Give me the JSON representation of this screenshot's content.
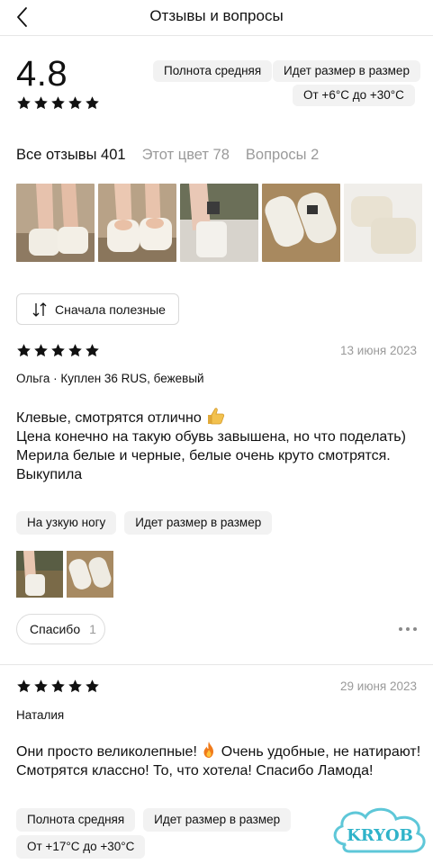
{
  "header": {
    "title": "Отзывы и вопросы",
    "back_icon": "chevron-left-icon"
  },
  "summary": {
    "rating": "4.8",
    "stars": 5,
    "chips": [
      "Полнота средняя",
      "Идет размер в размер",
      "От +6°C до +30°C"
    ]
  },
  "tabs": [
    {
      "label": "Все отзывы 401",
      "active": true
    },
    {
      "label": "Этот цвет 78",
      "active": false
    },
    {
      "label": "Вопросы 2",
      "active": false
    }
  ],
  "sort": {
    "label": "Сначала полезные",
    "icon": "sort-arrows-icon"
  },
  "reviews": [
    {
      "stars": 5,
      "date": "13 июня 2023",
      "author": "Ольга · Куплен 36 RUS, бежевый",
      "text_line_1": "Клевые, смотрятся отлично",
      "text_rest": "Цена конечно на такую обувь завышена, но что поделать)\nМерила белые и черные, белые очень круто смотрятся.\nВыкупила",
      "tags": [
        "На узкую ногу",
        "Идет размер в размер"
      ],
      "thanks_label": "Спасибо",
      "thanks_count": "1"
    },
    {
      "stars": 5,
      "date": "29 июня 2023",
      "author": "Наталия",
      "text_part_1": "Они просто великолепные!",
      "text_part_2": "Очень удобные, не натирают! Смотрятся классно! То, что хотела! Спасибо Ламода!",
      "tags": [
        "Полнота средняя",
        "Идет размер в размер"
      ],
      "tags_row2": [
        "От +17°C до +30°C"
      ]
    }
  ],
  "watermark": {
    "text": "KRYOB"
  },
  "colors": {
    "text": "#111111",
    "muted": "#9a9a9a",
    "chip_bg": "#f2f2f2",
    "divider": "#e6e6e6"
  }
}
